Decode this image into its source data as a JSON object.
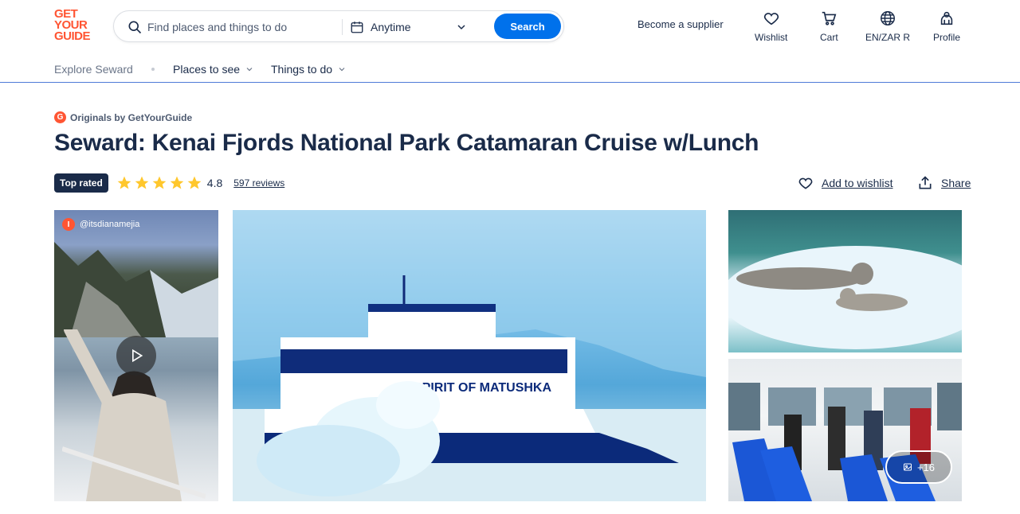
{
  "header": {
    "logo_lines": [
      "GET",
      "YOUR",
      "GUIDE"
    ],
    "search_placeholder": "Find places and things to do",
    "date_label": "Anytime",
    "search_button": "Search",
    "become_supplier": "Become a supplier",
    "nav": [
      {
        "label": "Wishlist",
        "icon": "heart-icon"
      },
      {
        "label": "Cart",
        "icon": "cart-icon"
      },
      {
        "label": "EN/ZAR R",
        "icon": "globe-icon"
      },
      {
        "label": "Profile",
        "icon": "profile-icon"
      }
    ]
  },
  "subnav": {
    "crumb": "Explore Seward",
    "menus": [
      "Places to see",
      "Things to do"
    ]
  },
  "product": {
    "originals": "Originals by GetYourGuide",
    "originals_mark": "G",
    "title": "Seward: Kenai Fjords National Park Catamaran Cruise w/Lunch",
    "badge": "Top rated",
    "stars": 5,
    "rating": "4.8",
    "reviews": "597 reviews",
    "add_to_wishlist": "Add to wishlist",
    "share": "Share"
  },
  "gallery": {
    "video_user": "@itsdianamejia",
    "video_user_mark": "I",
    "boat_name": "SPIRIT OF MATUSHKA",
    "more_count": "+16"
  },
  "colors": {
    "brand": "#ff5533",
    "primary": "#0071eb",
    "text": "#1a2b49",
    "star": "#ffc72c"
  }
}
